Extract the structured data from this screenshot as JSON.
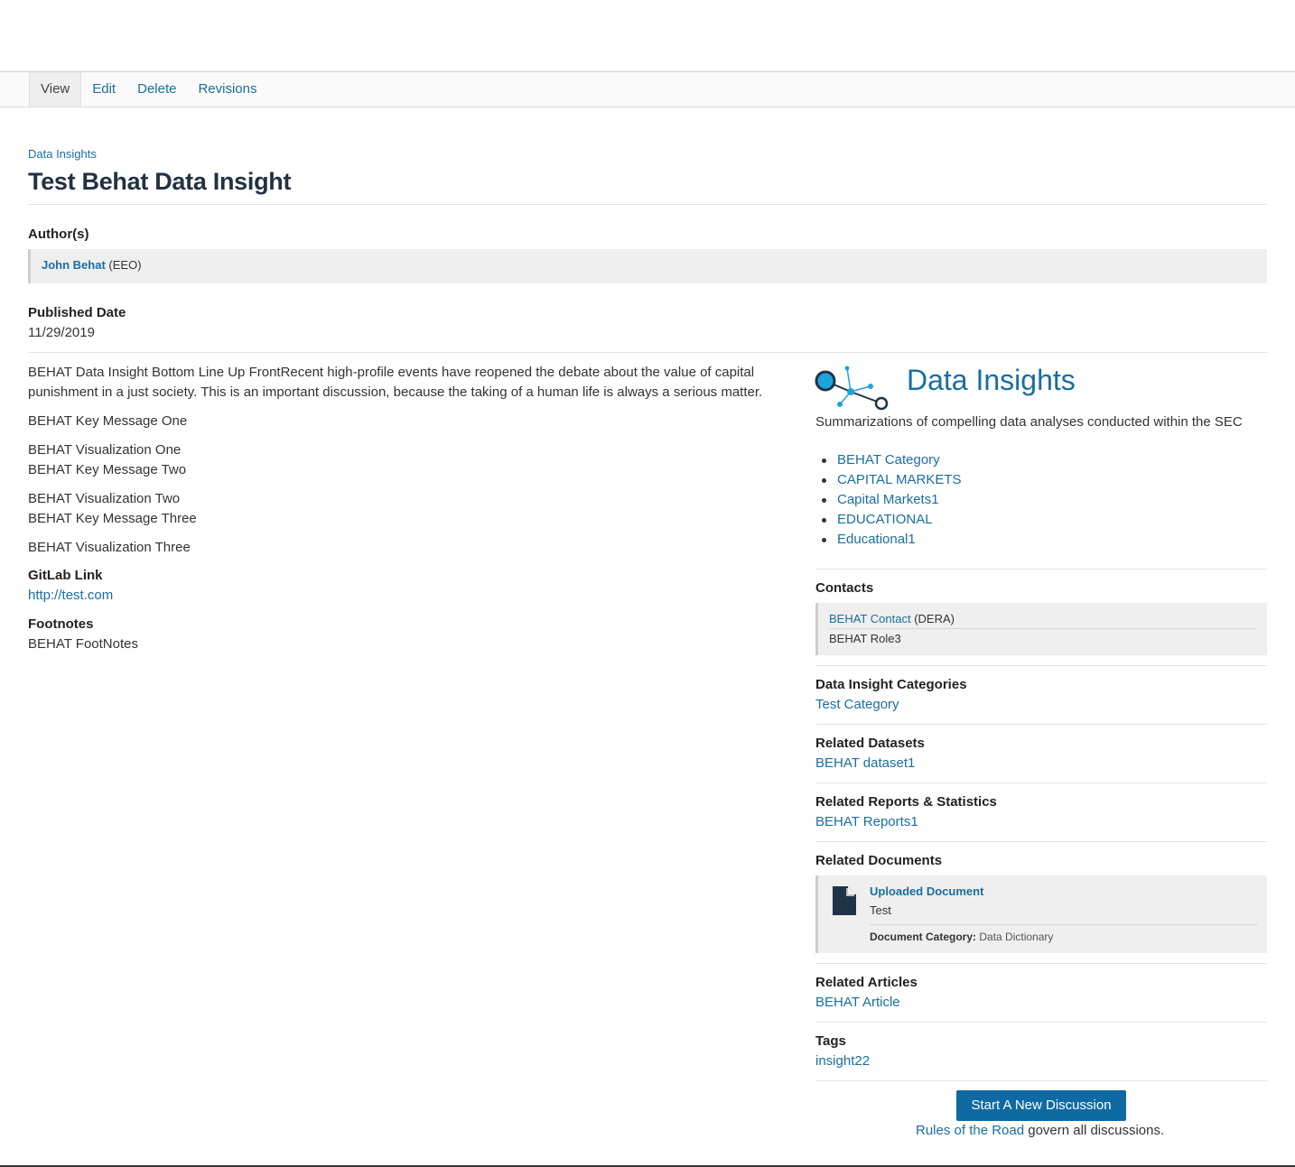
{
  "tabs": [
    {
      "label": "View"
    },
    {
      "label": "Edit"
    },
    {
      "label": "Delete"
    },
    {
      "label": "Revisions"
    }
  ],
  "breadcrumb": "Data Insights",
  "title": "Test Behat Data Insight",
  "authors": {
    "label": "Author(s)",
    "name": "John Behat",
    "org": "(EEO)"
  },
  "published": {
    "label": "Published Date",
    "value": "11/29/2019"
  },
  "body": {
    "intro": "BEHAT Data Insight Bottom Line Up FrontRecent high-profile events have reopened the debate about the value of capital punishment in a just society. This is an important discussion, because the taking of a human life is always a serious matter.",
    "key1": "BEHAT Key Message One",
    "vis1": "BEHAT Visualization One",
    "key2": "BEHAT Key Message Two",
    "vis2": "BEHAT Visualization Two",
    "key3": "BEHAT Key Message Three",
    "vis3": "BEHAT Visualization Three"
  },
  "gitlab": {
    "label": "GitLab Link",
    "url": "http://test.com"
  },
  "footnotes": {
    "label": "Footnotes",
    "value": "BEHAT FootNotes"
  },
  "sidebar": {
    "title": "Data Insights",
    "subtitle": "Summarizations of compelling data analyses conducted within the SEC",
    "categories": [
      "BEHAT Category",
      "CAPITAL MARKETS",
      "Capital Markets1",
      "EDUCATIONAL",
      "Educational1"
    ],
    "contacts": {
      "label": "Contacts",
      "name": "BEHAT Contact",
      "org": "(DERA)",
      "role": "BEHAT Role3"
    },
    "insight_categories": {
      "label": "Data Insight Categories",
      "value": "Test Category"
    },
    "datasets": {
      "label": "Related Datasets",
      "value": "BEHAT dataset1"
    },
    "reports": {
      "label": "Related Reports & Statistics",
      "value": "BEHAT Reports1"
    },
    "documents": {
      "label": "Related Documents",
      "name": "Uploaded Document",
      "desc": "Test",
      "category_label": "Document Category:",
      "category_value": "Data Dictionary"
    },
    "articles": {
      "label": "Related Articles",
      "value": "BEHAT Article"
    },
    "tags": {
      "label": "Tags",
      "value": "insight22"
    },
    "discussion_button": "Start A New Discussion",
    "rules_link": "Rules of the Road",
    "rules_text": " govern all discussions."
  },
  "colors": {
    "link": "#1a6e9e",
    "button": "#0f6aa3",
    "title": "#233142",
    "logo_accent": "#1fa3dd",
    "logo_dark": "#1e3346"
  }
}
